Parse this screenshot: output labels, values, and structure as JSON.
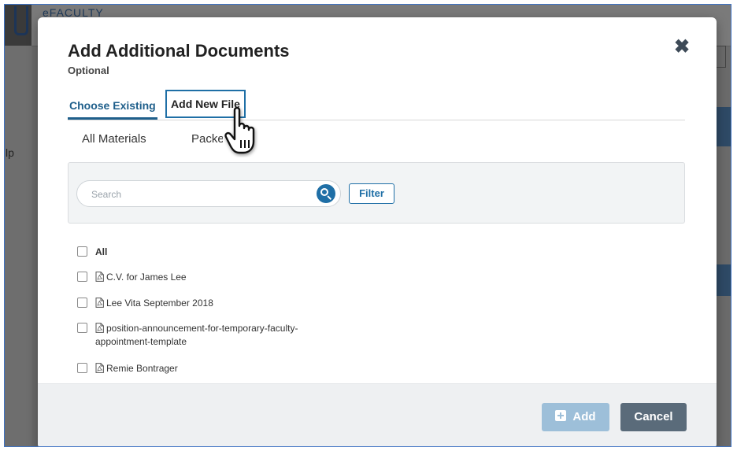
{
  "background": {
    "brand": "eFACULTY",
    "help_fragment": "lp"
  },
  "modal": {
    "title": "Add Additional Documents",
    "subtitle": "Optional",
    "close_icon": "close-icon",
    "tabs": [
      {
        "label": "Choose Existing",
        "active": true
      },
      {
        "label": "Add New File",
        "active": false,
        "focused": true
      }
    ],
    "subtabs": [
      {
        "label": "All Materials"
      },
      {
        "label": "Packets"
      }
    ],
    "search": {
      "placeholder": "Search",
      "value": "",
      "icon": "search-icon",
      "filter_label": "Filter"
    },
    "files": [
      {
        "label": "All",
        "is_all": true,
        "checked": false
      },
      {
        "label": "C.V. for James Lee",
        "icon": "pdf-icon",
        "checked": false
      },
      {
        "label": "Lee Vita September 2018",
        "icon": "pdf-icon",
        "checked": false
      },
      {
        "label": "position-announcement-for-temporary-faculty-",
        "label_line2": "appointment-template",
        "icon": "pdf-icon",
        "checked": false
      },
      {
        "label": "Remie Bontrager",
        "icon": "pdf-icon",
        "checked": false
      }
    ],
    "footer": {
      "add_label": "Add",
      "add_icon": "plus-square-icon",
      "add_disabled": true,
      "cancel_label": "Cancel"
    }
  },
  "colors": {
    "accent": "#1f6fa6",
    "tab_active": "#1f5f8b",
    "add_disabled": "#9dbfd9",
    "cancel": "#5a6b7a",
    "overlay": "#6b6b6b"
  }
}
